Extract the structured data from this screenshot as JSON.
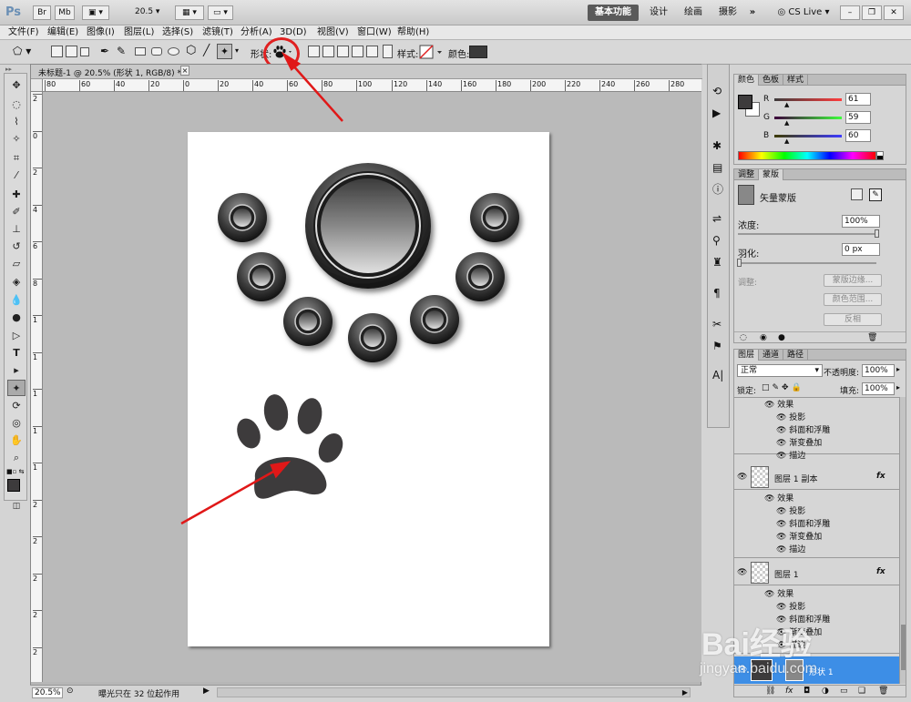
{
  "app": {
    "logo": "Ps",
    "bridge_btn": "Br",
    "minibridge_btn": "Mb",
    "zoom_value": "20.5",
    "workspaces": [
      "基本功能",
      "设计",
      "绘画",
      "摄影"
    ],
    "more": "»",
    "cslive": "CS Live"
  },
  "menus": [
    "文件(F)",
    "编辑(E)",
    "图像(I)",
    "图层(L)",
    "选择(S)",
    "滤镜(T)",
    "分析(A)",
    "3D(D)",
    "视图(V)",
    "窗口(W)",
    "帮助(H)"
  ],
  "options_bar": {
    "shape_label": "形状:",
    "style_label": "样式:",
    "color_label": "颜色:",
    "color_hex": "#3a3a3a",
    "highlight_color": "#e02020"
  },
  "document": {
    "tab_title": "未标题-1 @ 20.5% (形状 1, RGB/8) *",
    "close": "×",
    "ruler_h_labels": [
      "80",
      "60",
      "40",
      "20",
      "0",
      "20",
      "40",
      "60",
      "80",
      "100",
      "120",
      "140",
      "160",
      "180",
      "200",
      "220",
      "240",
      "260",
      "280"
    ],
    "ruler_v_labels": [
      "2",
      "0",
      "2",
      "4",
      "6",
      "8",
      "1",
      "1",
      "1",
      "1",
      "1",
      "2",
      "2",
      "2",
      "2",
      "2"
    ],
    "zoom": "20.5%",
    "status_text": "曝光只在 32 位起作用"
  },
  "color_panel": {
    "tabs": [
      "颜色",
      "色板",
      "样式"
    ],
    "rows": [
      {
        "label": "R",
        "value": "61"
      },
      {
        "label": "G",
        "value": "59"
      },
      {
        "label": "B",
        "value": "60"
      }
    ]
  },
  "masks_panel": {
    "tabs": [
      "调整",
      "蒙版"
    ],
    "title": "矢量蒙版",
    "density_label": "浓度:",
    "density_value": "100%",
    "feather_label": "羽化:",
    "feather_value": "0 px",
    "refine_label": "调整:",
    "btn_mask_edge": "蒙版边缘...",
    "btn_color_range": "颜色范围...",
    "btn_invert": "反相"
  },
  "layers_panel": {
    "tabs": [
      "图层",
      "通道",
      "路径"
    ],
    "blend_mode": "正常",
    "opacity_label": "不透明度:",
    "opacity_value": "100%",
    "lock_label": "锁定:",
    "fill_label": "填充:",
    "fill_value": "100%",
    "effects_group1": [
      "效果",
      "投影",
      "斜面和浮雕",
      "渐变叠加",
      "描边"
    ],
    "layer_copy_name": "图层 1 副本",
    "effects_group2": [
      "效果",
      "投影",
      "斜面和浮雕",
      "渐变叠加",
      "描边"
    ],
    "layer1_name": "图层 1",
    "effects_group3": [
      "效果",
      "投影",
      "斜面和浮雕",
      "渐变叠加",
      "描边"
    ],
    "shape_layer_name": "形状 1",
    "fx": "fx"
  },
  "watermark": {
    "line1": "Bai经验",
    "line2": "jingyan.baidu.com"
  }
}
